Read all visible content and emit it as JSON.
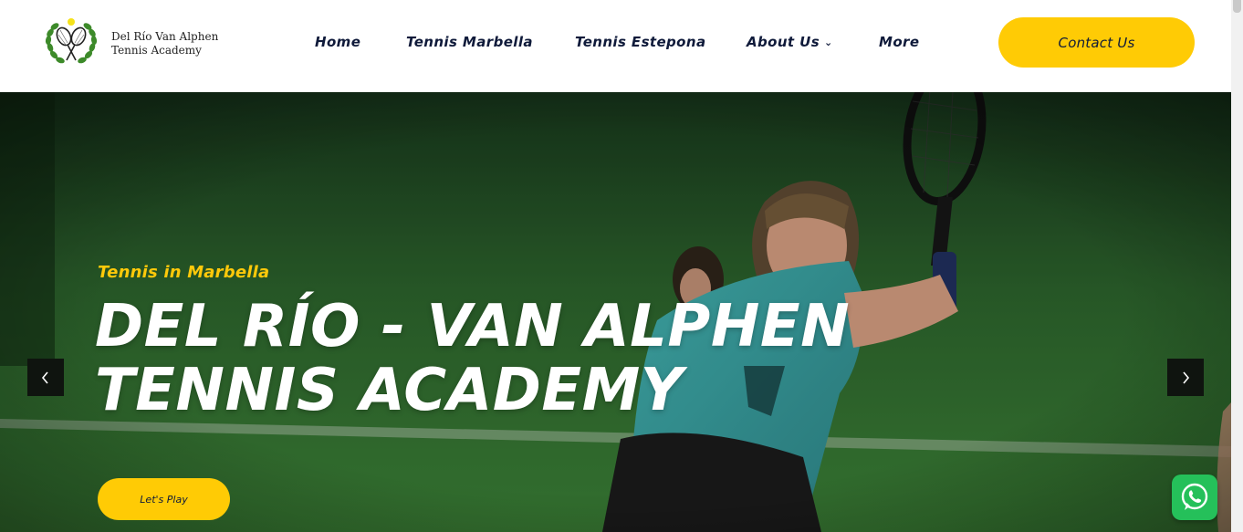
{
  "brand": {
    "line1": "Del Río Van Alphen",
    "line2": "Tennis Academy"
  },
  "nav": {
    "items": [
      {
        "label": "Home"
      },
      {
        "label": "Tennis Marbella"
      },
      {
        "label": "Tennis Estepona"
      },
      {
        "label": "About Us",
        "has_dropdown": true
      },
      {
        "label": "More"
      }
    ],
    "dropdown_icon": "chevron-down-icon",
    "contact_label": "Contact Us"
  },
  "hero": {
    "eyebrow": "Tennis in Marbella",
    "title_line1": "DEL RÍO - VAN ALPHEN",
    "title_line2": "TENNIS ACADEMY",
    "cta_label": "Let's Play",
    "prev_icon": "chevron-left-icon",
    "next_icon": "chevron-right-icon"
  },
  "floating": {
    "chat_icon": "whatsapp-icon"
  },
  "colors": {
    "accent": "#ffcb05",
    "nav_text": "#0f1a3a",
    "hero_green": "#2d6a2d",
    "whatsapp": "#25c05a"
  }
}
